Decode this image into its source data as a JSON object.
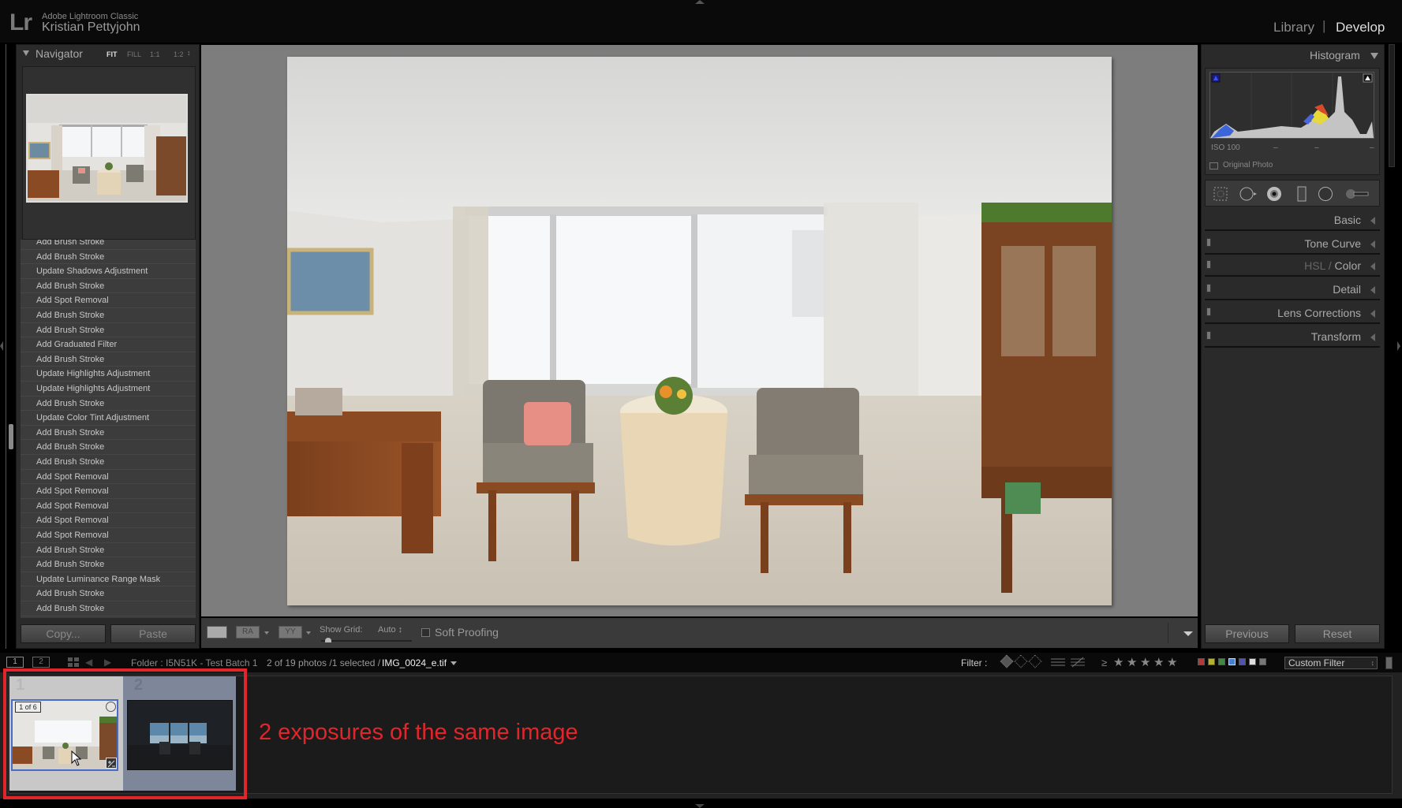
{
  "app": {
    "logo": "Lr",
    "product_name": "Adobe Lightroom Classic",
    "user_name": "Kristian Pettyjohn",
    "modules": [
      {
        "label": "Library",
        "active": false
      },
      {
        "label": "Develop",
        "active": true
      }
    ],
    "module_separator": "|"
  },
  "navigator": {
    "title": "Navigator",
    "zoom_options": [
      "FIT",
      "FILL",
      "1:1",
      "1:2"
    ],
    "selected_zoom": "FIT",
    "spinner": "↕"
  },
  "history": {
    "items": [
      "Add Brush Stroke",
      "Add Brush Stroke",
      "Update Shadows Adjustment",
      "Add Brush Stroke",
      "Add Spot Removal",
      "Add Brush Stroke",
      "Add Brush Stroke",
      "Add Graduated Filter",
      "Add Brush Stroke",
      "Update Highlights Adjustment",
      "Update Highlights Adjustment",
      "Add Brush Stroke",
      "Update Color Tint Adjustment",
      "Add Brush Stroke",
      "Add Brush Stroke",
      "Add Brush Stroke",
      "Add Spot Removal",
      "Add Spot Removal",
      "Add Spot Removal",
      "Add Spot Removal",
      "Add Spot Removal",
      "Add Brush Stroke",
      "Add Brush Stroke",
      "Update Luminance Range Mask",
      "Add Brush Stroke",
      "Add Brush Stroke"
    ]
  },
  "left_buttons": {
    "copy": "Copy...",
    "paste": "Paste"
  },
  "toolbar": {
    "view_ra": "RA",
    "view_yy": "YY",
    "show_grid_label": "Show Grid:",
    "show_grid_value": "Auto ↕",
    "soft_proofing_label": "Soft Proofing",
    "soft_proofing_checked": false
  },
  "histogram": {
    "title": "Histogram",
    "iso": "ISO 100",
    "readouts": [
      "–",
      "–",
      "–"
    ],
    "original_photo_label": "Original Photo"
  },
  "tools": [
    "crop-overlay",
    "spot-removal",
    "red-eye",
    "graduated-filter",
    "radial-filter",
    "adjustment-brush"
  ],
  "panels": [
    {
      "label": "Basic",
      "has_switch": false
    },
    {
      "label": "Tone Curve",
      "has_switch": true
    },
    {
      "label_dim": "HSL / ",
      "label": "Color",
      "has_switch": true
    },
    {
      "label": "Detail",
      "has_switch": true
    },
    {
      "label": "Lens Corrections",
      "has_switch": true
    },
    {
      "label": "Transform",
      "has_switch": true
    }
  ],
  "right_buttons": {
    "previous": "Previous",
    "reset": "Reset"
  },
  "filmstrip_bar": {
    "screen_1": "1",
    "screen_2": "2",
    "folder": "Folder : I5N51K - Test Batch 1",
    "count": "2 of 19 photos /1 selected /",
    "file_name": "IMG_0024_e.tif",
    "filter_label": "Filter :",
    "rating_operator": "≥",
    "stars": 5,
    "color_labels": [
      "#b33a3a",
      "#b3b03a",
      "#3f8a3f",
      "#4a7fd0",
      "#5252b0",
      "#dddddd",
      "#777777"
    ],
    "custom_filter": "Custom Filter"
  },
  "filmstrip": {
    "cells": [
      {
        "index": "1",
        "stack_badge": "1 of 6",
        "selected": true
      },
      {
        "index": "2",
        "selected": false
      }
    ]
  },
  "annotation": {
    "text": "2 exposures of the same image",
    "color": "#e0262b"
  }
}
